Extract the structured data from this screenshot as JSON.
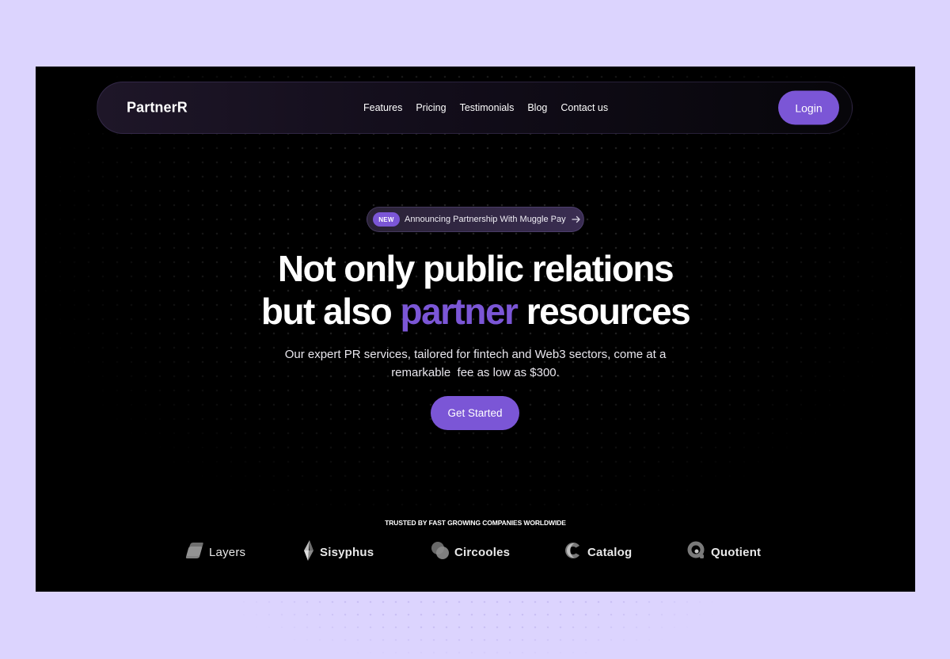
{
  "colors": {
    "accent": "#7b56d6",
    "page_background": "#dcd4fe",
    "hero_background": "#000000"
  },
  "nav": {
    "brand": "PartnerR",
    "links": [
      "Features",
      "Pricing",
      "Testimonials",
      "Blog",
      "Contact us"
    ],
    "login_label": "Login"
  },
  "announcement": {
    "badge": "NEW",
    "text": "Announcing Partnership With Muggle Pay",
    "icon": "arrow-right-icon"
  },
  "hero": {
    "headline_line1": "Not only public relations",
    "headline_line2_prefix": "but also ",
    "headline_line2_accent": "partner",
    "headline_line2_suffix": " resources",
    "subtitle_line1": "Our expert PR services, tailored for fintech and Web3 sectors, come at a",
    "subtitle_line2": "remarkable  fee as low as $300.",
    "cta_label": "Get Started"
  },
  "trusted": {
    "heading": "TRUSTED BY FAST GROWING COMPANIES WORLDWIDE",
    "logos": [
      {
        "name": "Layers",
        "icon": "layers-logo-icon"
      },
      {
        "name": "Sisyphus",
        "icon": "sisyphus-logo-icon"
      },
      {
        "name": "Circooles",
        "icon": "circooles-logo-icon"
      },
      {
        "name": "Catalog",
        "icon": "catalog-logo-icon"
      },
      {
        "name": "Quotient",
        "icon": "quotient-logo-icon"
      }
    ]
  }
}
